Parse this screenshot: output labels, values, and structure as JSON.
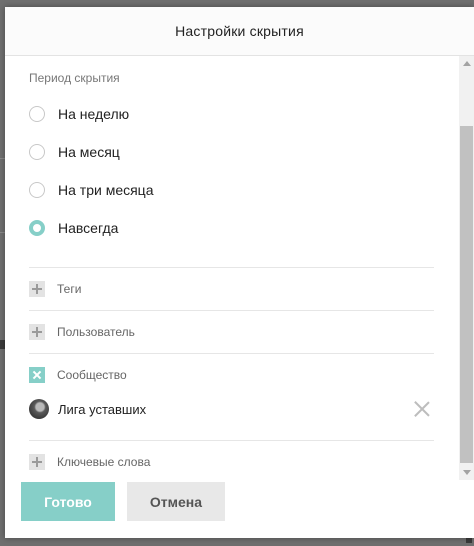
{
  "modal": {
    "title": "Настройки скрытия"
  },
  "period": {
    "title": "Период скрытия",
    "options": [
      {
        "label": "На неделю",
        "checked": false
      },
      {
        "label": "На месяц",
        "checked": false
      },
      {
        "label": "На три месяца",
        "checked": false
      },
      {
        "label": "Навсегда",
        "checked": true
      }
    ]
  },
  "filters": {
    "tags": {
      "label": "Теги",
      "expanded": false
    },
    "user": {
      "label": "Пользователь",
      "expanded": false
    },
    "community": {
      "label": "Сообщество",
      "expanded": true,
      "items": [
        {
          "label": "Лига уставших"
        }
      ]
    },
    "keywords": {
      "label": "Ключевые слова",
      "expanded": false
    }
  },
  "footer": {
    "ok_label": "Готово",
    "cancel_label": "Отмена"
  },
  "colors": {
    "accent": "#86cfc8",
    "cancel_bg": "#e8e8e8",
    "text": "#222222"
  }
}
